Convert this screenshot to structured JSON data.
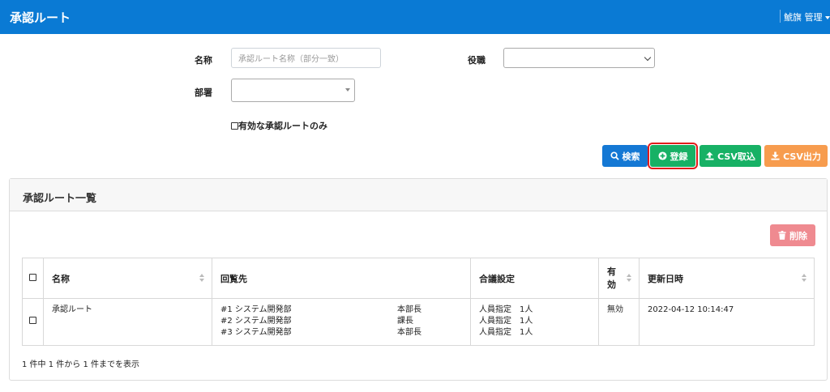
{
  "header": {
    "title": "承認ルート",
    "user_label": "鯱旗 管理"
  },
  "search_form": {
    "name_label": "名称",
    "name_placeholder": "承認ルート名称（部分一致）",
    "role_label": "役職",
    "role_value": "",
    "dept_label": "部署",
    "dept_value": "",
    "active_only_label": "有効な承認ルートのみ",
    "active_only_checked": false
  },
  "actions": {
    "search_label": "検索",
    "register_label": "登録",
    "csv_import_label": "CSV取込",
    "csv_export_label": "CSV出力"
  },
  "list_panel": {
    "title": "承認ルート一覧",
    "delete_label": "削除",
    "columns": {
      "name": "名称",
      "route": "回覧先",
      "consensus": "合議設定",
      "active_line1": "有",
      "active_line2": "効",
      "updated": "更新日時"
    },
    "rows": [
      {
        "name": "承認ルート",
        "route": [
          {
            "dept": "#1 システム開発部",
            "role": "本部長"
          },
          {
            "dept": "#2 システム開発部",
            "role": "課長"
          },
          {
            "dept": "#3 システム開発部",
            "role": "本部長"
          }
        ],
        "consensus": [
          "人員指定　1人",
          "人員指定　1人",
          "人員指定　1人"
        ],
        "active": "無効",
        "updated": "2022-04-12 10:14:47"
      }
    ],
    "footer": "1 件中 1 件から 1 件までを表示"
  },
  "colors": {
    "header_bg": "#0a7ad4",
    "search_btn": "#1478d4",
    "register_btn": "#17b165",
    "csv_import_btn": "#17b165",
    "csv_export_btn": "#f79c4e",
    "delete_btn": "#ef8a90",
    "highlight_outline": "#e21b1b"
  },
  "icons": {
    "search": "search-icon",
    "register": "plus-circle-icon",
    "csv_import": "upload-icon",
    "csv_export": "download-icon",
    "delete": "trash-icon",
    "user_menu": "caret-down-icon"
  }
}
